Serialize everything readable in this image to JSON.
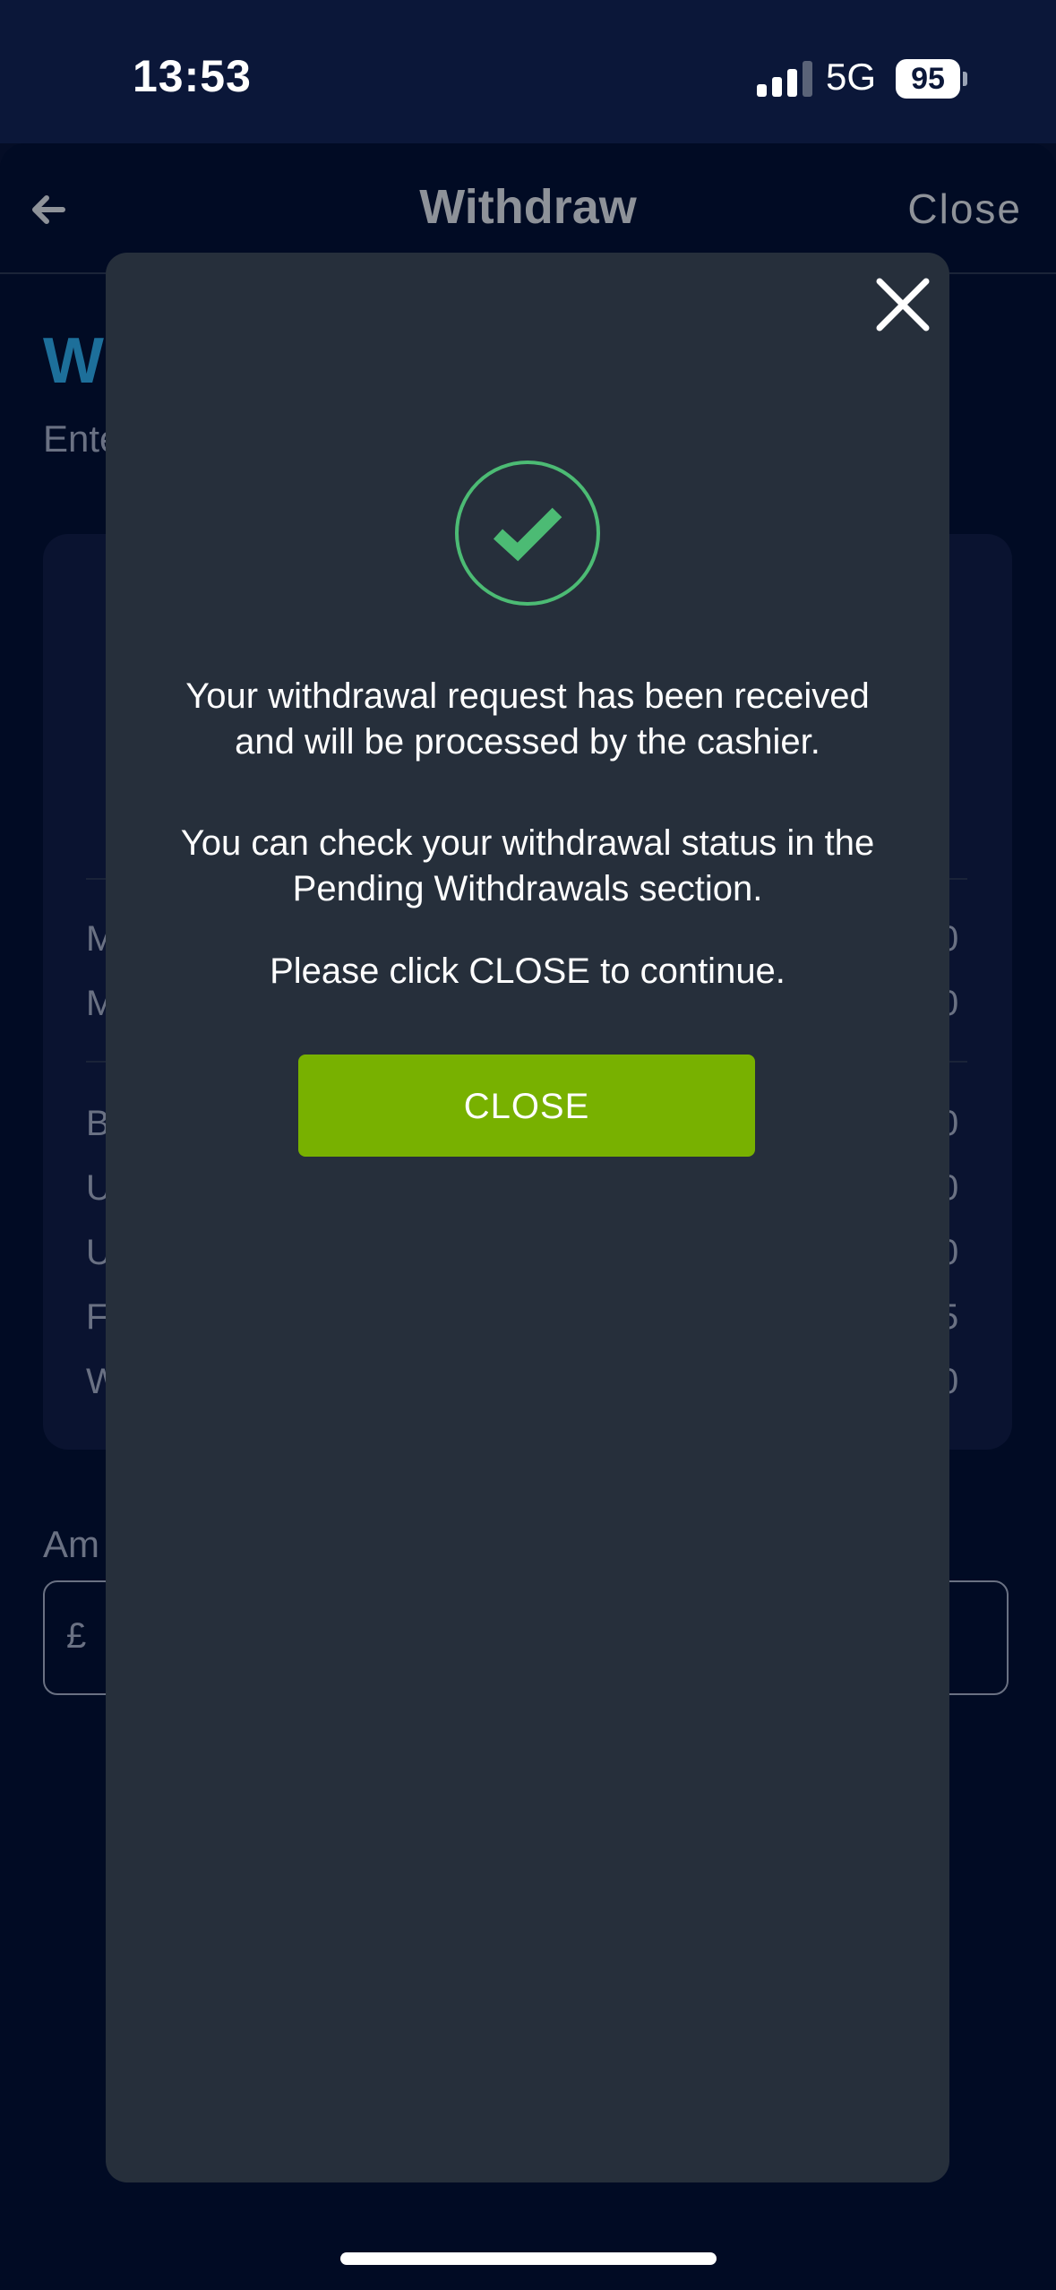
{
  "status_bar": {
    "time": "13:53",
    "network": "5G",
    "battery": "95"
  },
  "nav": {
    "title": "Withdraw",
    "close_label": "Close"
  },
  "background": {
    "heading_partial": "W",
    "subtitle_partial": "Ente",
    "rows_top": [
      {
        "letter": "M",
        "value": "0"
      },
      {
        "letter": "M",
        "value": "0"
      }
    ],
    "rows_bottom": [
      {
        "letter": "B",
        "value": "0"
      },
      {
        "letter": "U",
        "value": "0"
      },
      {
        "letter": "U",
        "value": "0"
      },
      {
        "letter": "F",
        "value": "5"
      },
      {
        "letter": "W",
        "value": "0"
      }
    ],
    "amount_label_partial": "Am",
    "currency_symbol": "£"
  },
  "modal": {
    "message_line1": "Your withdrawal request has been received and will be processed by the cashier.",
    "message_line2": "You can check your withdrawal status in the Pending Withdrawals section.",
    "message_line3": "Please click CLOSE to continue.",
    "close_button_label": "CLOSE",
    "icon": "check-circle-icon"
  },
  "colors": {
    "accent_green": "#78b100",
    "success_green": "#4cbb74",
    "modal_bg": "#262f3b",
    "page_bg": "#010b24"
  }
}
